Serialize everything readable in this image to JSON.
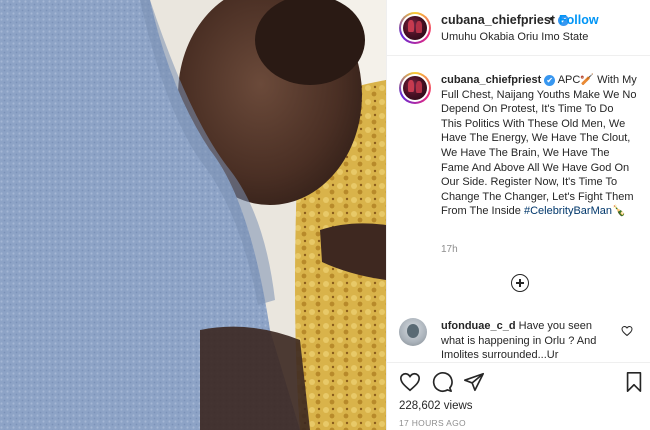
{
  "post": {
    "username": "cubana_chiefpriest",
    "verified_mark": "✔",
    "follow_separator": "•",
    "follow_label": "Follow",
    "location": "Umuhu Okabia Oriu Imo State",
    "caption_before_hashtag": "APC🏏 With My Full Chest, Naijang Youths Make We No Depend On Protest, It's Time To Do This Politics With These Old Men, We Have The Energy, We Have The Clout, We Have The Brain, We Have The Fame And Above All We Have God On Our Side. Register Now, It's Time To Change The Changer, Let's Fight Them From The Inside",
    "hashtag": "#CelebrityBarMan",
    "hashtag_emoji": "🍾",
    "caption_time": "17h",
    "likes": "228,602 views",
    "posted_ago": "17 HOURS AGO"
  },
  "comment": {
    "username": "ufonduae_c_d",
    "text": "Have you seen what is happening in Orlu ? And Imolites surrounded...Ur"
  },
  "icons": {
    "load_more": "plus-circle-icon",
    "like": "heart-icon",
    "comment": "comment-icon",
    "share": "send-icon",
    "save": "bookmark-icon",
    "comment_like": "heart-icon"
  },
  "colors": {
    "follow": "#0095f6",
    "verified": "#3897f0",
    "hashtag": "#00376b",
    "muted": "#8e8e8e"
  }
}
